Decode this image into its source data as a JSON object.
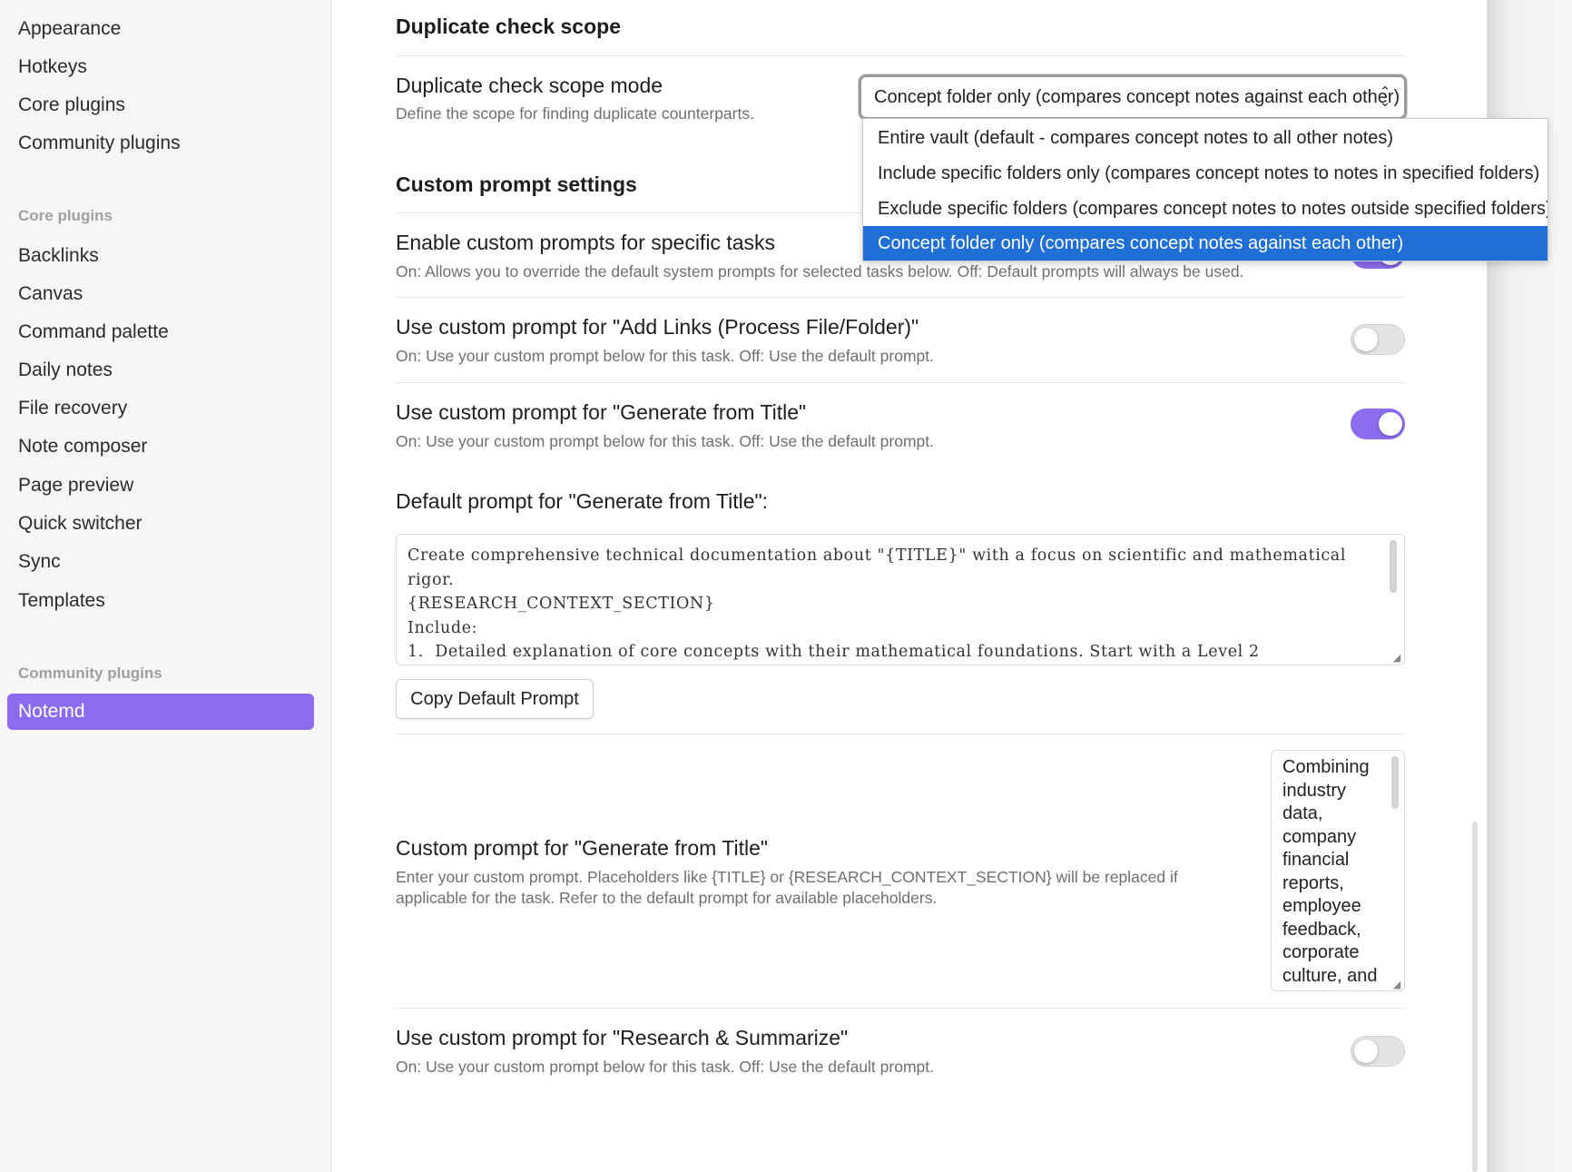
{
  "sidebar": {
    "options_items": [
      "Appearance",
      "Hotkeys",
      "Core plugins",
      "Community plugins"
    ],
    "core_group_label": "Core plugins",
    "core_items": [
      "Backlinks",
      "Canvas",
      "Command palette",
      "Daily notes",
      "File recovery",
      "Note composer",
      "Page preview",
      "Quick switcher",
      "Sync",
      "Templates"
    ],
    "community_group_label": "Community plugins",
    "community_items": [
      "Notemd"
    ],
    "active_item": "Notemd"
  },
  "duplicate": {
    "heading": "Duplicate check scope",
    "mode_label": "Duplicate check scope mode",
    "mode_desc": "Define the scope for finding duplicate counterparts.",
    "selected_value": "Concept folder only (compares concept notes against each other)",
    "options": [
      "Entire vault (default - compares concept notes to all other notes)",
      "Include specific folders only (compares concept notes to notes in specified folders)",
      "Exclude specific folders (compares concept notes to notes outside specified folders)",
      "Concept folder only (compares concept notes against each other)"
    ]
  },
  "custom": {
    "heading": "Custom prompt settings",
    "enable_label": "Enable custom prompts for specific tasks",
    "enable_desc": "On: Allows you to override the default system prompts for selected tasks below. Off: Default prompts will always be used.",
    "enable_on": true,
    "add_links_label": "Use custom prompt for \"Add Links (Process File/Folder)\"",
    "add_links_desc": "On: Use your custom prompt below for this task. Off: Use the default prompt.",
    "add_links_on": false,
    "gen_title_label": "Use custom prompt for \"Generate from Title\"",
    "gen_title_desc": "On: Use your custom prompt below for this task. Off: Use the default prompt.",
    "gen_title_on": true,
    "default_prompt_label": "Default prompt for \"Generate from Title\":",
    "default_prompt_text": "Create comprehensive technical documentation about \"{TITLE}\" with a focus on scientific and mathematical\nrigor.\n{RESEARCH_CONTEXT_SECTION}\nInclude:\n1.  Detailed explanation of core concepts with their mathematical foundations. Start with a Level 2",
    "copy_button": "Copy Default Prompt",
    "custom_prompt_label": "Custom prompt for \"Generate from Title\"",
    "custom_prompt_desc": "Enter your custom prompt. Placeholders like {TITLE} or {RESEARCH_CONTEXT_SECTION} will be replaced if applicable for the task. Refer to the default prompt for available placeholders.",
    "custom_prompt_value": "Combining industry data, company financial reports, employee feedback, corporate culture, and",
    "research_label": "Use custom prompt for \"Research & Summarize\"",
    "research_desc": "On: Use your custom prompt below for this task. Off: Use the default prompt.",
    "research_on": false
  }
}
